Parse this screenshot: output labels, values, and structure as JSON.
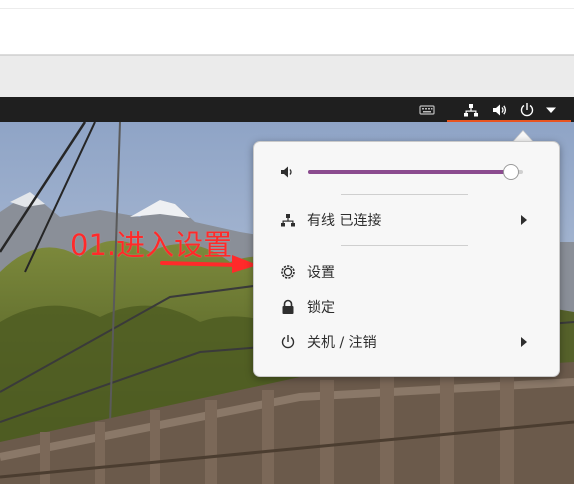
{
  "topbar": {
    "icons": [
      "keyboard-icon",
      "network-wired-icon",
      "volume-icon",
      "power-icon",
      "dropdown-arrow-icon"
    ]
  },
  "annotation": {
    "text": "01.进入设置",
    "color": "#ff2a2a"
  },
  "system_menu": {
    "volume": {
      "level": 0.94,
      "icon": "volume-icon"
    },
    "wired": {
      "label": "有线 已连接",
      "icon": "network-wired-icon"
    },
    "settings": {
      "label": "设置",
      "icon": "settings-gear-icon"
    },
    "lock": {
      "label": "锁定",
      "icon": "lock-icon"
    },
    "power": {
      "label": "关机 / 注销",
      "icon": "power-icon"
    }
  },
  "colors": {
    "panel": "#1f1f1f",
    "accent": "#e95420",
    "slider": "#8b4c8f",
    "menu_bg": "#f7f7f7"
  }
}
